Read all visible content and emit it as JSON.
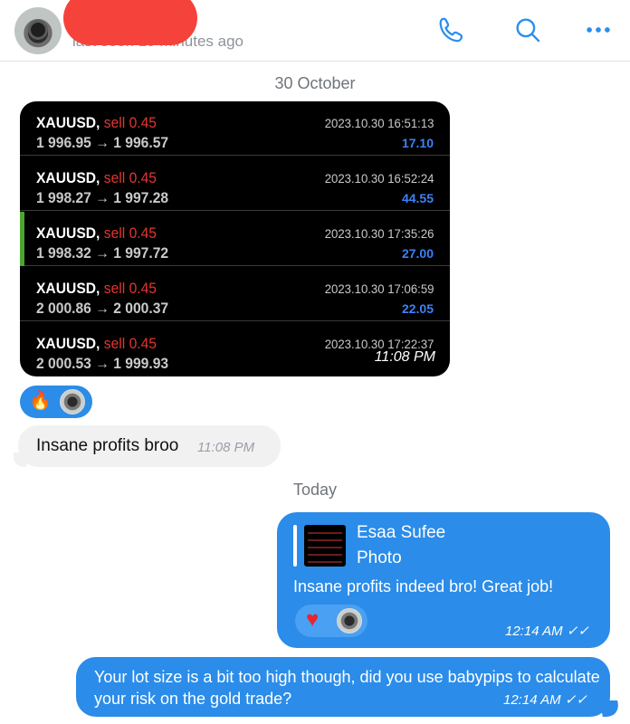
{
  "header": {
    "status": "last seen 19 minutes ago",
    "icons": [
      "phone-icon",
      "search-icon",
      "more-icon"
    ],
    "accent_color": "#2a8ef0"
  },
  "dates": {
    "first": "30 October",
    "second": "Today"
  },
  "trades": [
    {
      "symbol": "XAUUSD,",
      "side": "sell 0.45",
      "prices": "1 996.95 → 1 996.57",
      "timestamp": "2023.10.30 16:51:13",
      "profit": "17.10"
    },
    {
      "symbol": "XAUUSD,",
      "side": "sell 0.45",
      "prices": "1 998.27 → 1 997.28",
      "timestamp": "2023.10.30 16:52:24",
      "profit": "44.55"
    },
    {
      "symbol": "XAUUSD,",
      "side": "sell 0.45",
      "prices": "1 998.32 → 1 997.72",
      "timestamp": "2023.10.30 17:35:26",
      "profit": "27.00"
    },
    {
      "symbol": "XAUUSD,",
      "side": "sell 0.45",
      "prices": "2 000.86 → 2 000.37",
      "timestamp": "2023.10.30 17:06:59",
      "profit": "22.05"
    },
    {
      "symbol": "XAUUSD,",
      "side": "sell 0.45",
      "prices": "2 000.53 → 1 999.93",
      "timestamp": "2023.10.30 17:22:37",
      "profit": ""
    }
  ],
  "trade_card_time": "11:08 PM",
  "incoming": {
    "text": "Insane profits broo",
    "time": "11:08 PM"
  },
  "reactions_photo": [
    "fire-emoji",
    "avatar"
  ],
  "outgoing1": {
    "reply_name": "Esaa Sufee",
    "reply_type": "Photo",
    "text": "Insane profits indeed bro! Great job!",
    "time": "12:14 AM",
    "reactions": [
      "heart-emoji",
      "avatar"
    ]
  },
  "outgoing2": {
    "text": "Your lot size is a bit too high though, did you use babypips to calculate your risk on the gold trade?",
    "time": "12:14 AM"
  },
  "colors": {
    "bubble_out": "#2b8ce9",
    "bubble_in": "#f1f1f2",
    "sell": "#e43530",
    "profit": "#3b82f6",
    "accent_row": "#4ca52e"
  }
}
